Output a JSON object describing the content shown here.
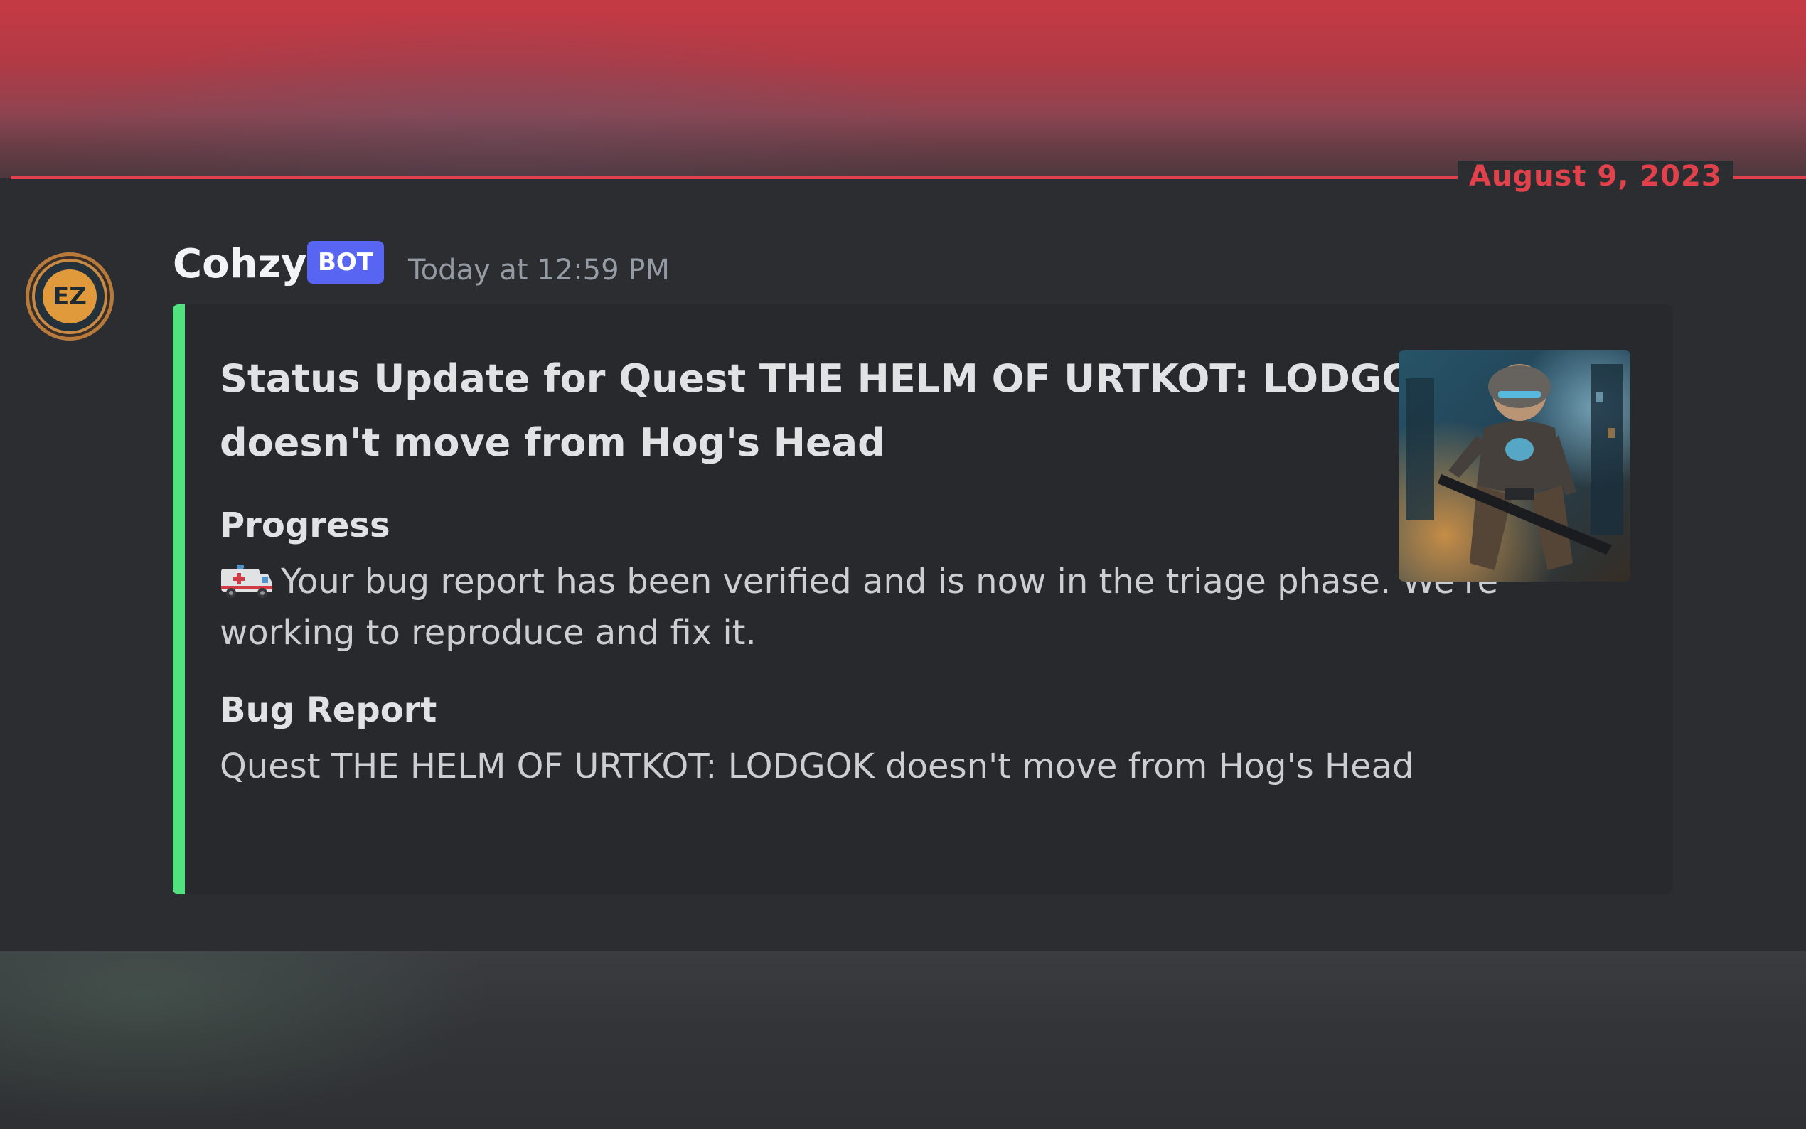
{
  "divider": {
    "date": "August 9, 2023"
  },
  "message": {
    "author": "Cohzy",
    "badge": "BOT",
    "timestamp": "Today at 12:59 PM",
    "avatar_icon": "ez-avatar-icon",
    "avatar_text": "EZ"
  },
  "embed": {
    "accent_color": "#57f287",
    "title": "Status Update for Quest THE HELM OF URTKOT: LODGOK doesn't move from Hog's Head",
    "fields": [
      {
        "name": "Progress",
        "icon": "ambulance-icon",
        "value": "Your bug report has been verified and is now in the triage phase. We're working to reproduce and fix it."
      },
      {
        "name": "Bug Report",
        "value": "Quest THE HELM OF URTKOT: LODGOK doesn't move from Hog's Head"
      }
    ],
    "thumbnail_icon": "armored-soldier-thumbnail"
  },
  "colors": {
    "divider": "#e0414b",
    "bot_badge": "#5865f2",
    "background": "#2b2d31"
  }
}
